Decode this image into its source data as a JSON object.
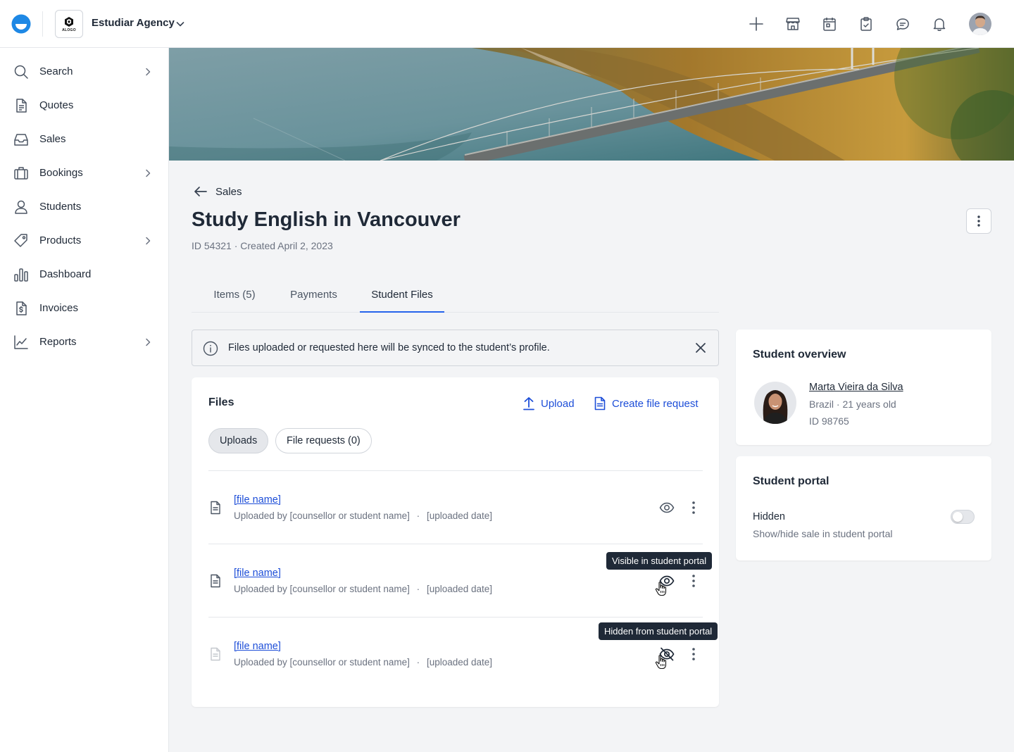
{
  "topbar": {
    "agency_name": "Estudiar Agency",
    "agency_logo_text": "ALOGO",
    "icons": [
      "plus-icon",
      "storefront-icon",
      "calendar-icon",
      "clipboard-check-icon",
      "chat-icon",
      "bell-icon"
    ]
  },
  "sidebar": {
    "items": [
      {
        "label": "Search",
        "icon": "search-icon",
        "has_submenu": true
      },
      {
        "label": "Quotes",
        "icon": "document-icon",
        "has_submenu": false
      },
      {
        "label": "Sales",
        "icon": "inbox-tray-icon",
        "has_submenu": false
      },
      {
        "label": "Bookings",
        "icon": "luggage-icon",
        "has_submenu": true
      },
      {
        "label": "Students",
        "icon": "user-icon",
        "has_submenu": false
      },
      {
        "label": "Products",
        "icon": "tag-icon",
        "has_submenu": true
      },
      {
        "label": "Dashboard",
        "icon": "bar-chart-icon",
        "has_submenu": false
      },
      {
        "label": "Invoices",
        "icon": "invoice-icon",
        "has_submenu": false
      },
      {
        "label": "Reports",
        "icon": "line-chart-icon",
        "has_submenu": true
      }
    ]
  },
  "header": {
    "back_label": "Sales",
    "title": "Study English in Vancouver",
    "meta": "ID 54321 · Created April 2, 2023"
  },
  "tabs": [
    {
      "label": "Items (5)",
      "active": false
    },
    {
      "label": "Payments",
      "active": false
    },
    {
      "label": "Student Files",
      "active": true
    }
  ],
  "banner": {
    "message": "Files uploaded or requested here will be synced to the student’s profile."
  },
  "files": {
    "title": "Files",
    "upload_label": "Upload",
    "create_request_label": "Create file request",
    "filters": [
      {
        "label": "Uploads",
        "selected": true
      },
      {
        "label": "File requests (0)",
        "selected": false
      }
    ],
    "rows": [
      {
        "name": "[file name]",
        "uploaded_by": "Uploaded by [counsellor or student name]",
        "separator": "·",
        "date": "[uploaded date]",
        "visibility": "visible"
      },
      {
        "name": "[file name]",
        "uploaded_by": "Uploaded by [counsellor or student name]",
        "separator": "·",
        "date": "[uploaded date]",
        "visibility": "visible"
      },
      {
        "name": "[file name]",
        "uploaded_by": "Uploaded by [counsellor or student name]",
        "separator": "·",
        "date": "[uploaded date]",
        "visibility": "hidden"
      }
    ],
    "tooltips": {
      "visible": "Visible in student portal",
      "hidden": "Hidden from student portal"
    }
  },
  "student_overview": {
    "title": "Student overview",
    "name": "Marta Vieira da Silva",
    "details": "Brazil · 21 years old",
    "id": "ID 98765"
  },
  "student_portal": {
    "title": "Student portal",
    "status": "Hidden",
    "help": "Show/hide sale in student portal",
    "enabled": false
  },
  "colors": {
    "accent": "#2563eb",
    "link": "#1d4ed8",
    "brand": "#1e88e5",
    "tooltip_bg": "#1f2937"
  }
}
